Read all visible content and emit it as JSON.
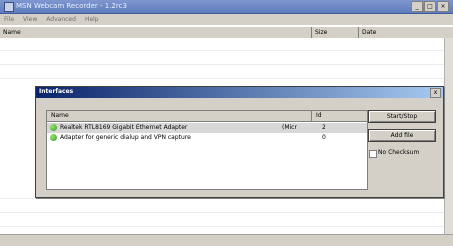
{
  "window": {
    "title": "MSN Webcam Recorder - 1.2rc3",
    "buttons": [
      "_",
      "□",
      "×"
    ]
  },
  "menu": [
    "File",
    "View",
    "Advanced",
    "Help"
  ],
  "main_list": {
    "columns": [
      "Name",
      "Size",
      "Date"
    ]
  },
  "dialog": {
    "title": "Interfaces",
    "close_label": "x",
    "list_columns": [
      "Name",
      "Id"
    ],
    "rows": [
      {
        "name": "Realtek RTL8169 Gigabit Ethernet Adapter",
        "extra": "(Micr",
        "id": "2",
        "selected": true
      },
      {
        "name": "Adapter for generic dialup and VPN capture",
        "extra": "",
        "id": "0",
        "selected": false
      }
    ],
    "buttons": {
      "start_stop": "Start/Stop",
      "add_file": "Add file"
    },
    "checkbox_label": "No Checksum",
    "status_color": "#2f9a1a"
  }
}
